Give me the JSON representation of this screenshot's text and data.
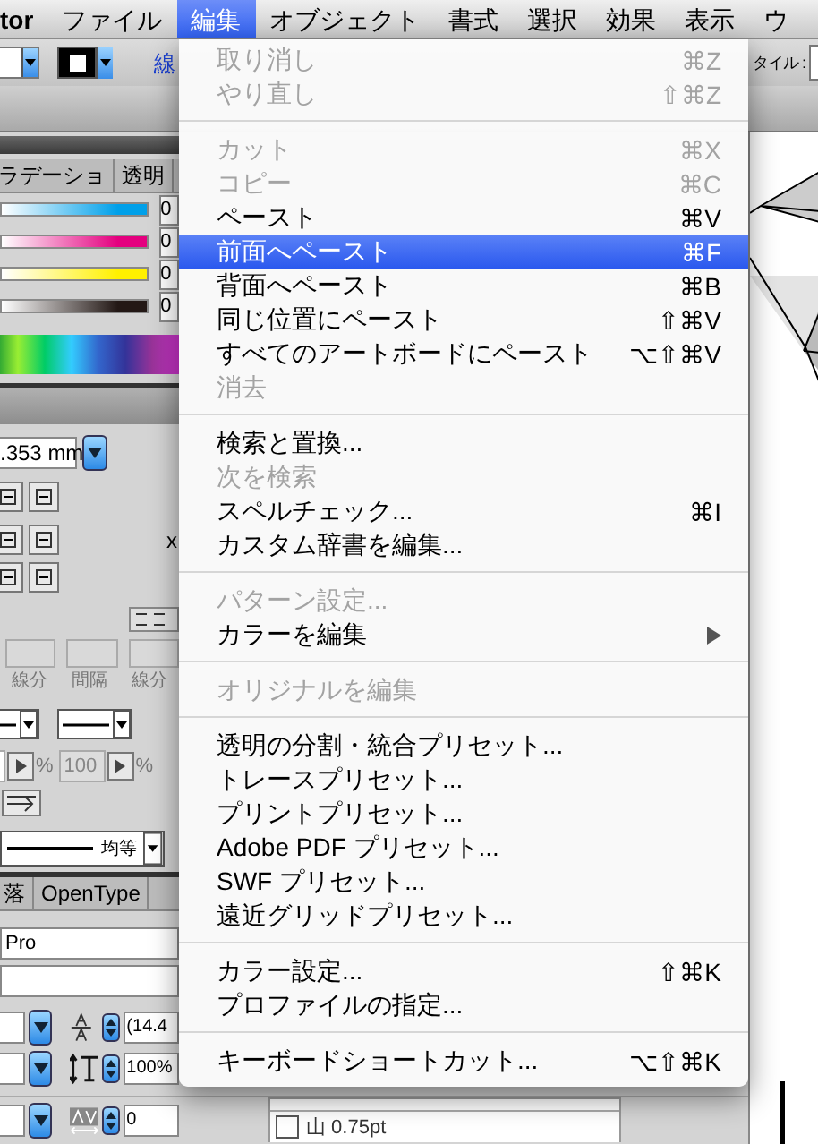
{
  "menubar": [
    {
      "label": "tor",
      "selected": false
    },
    {
      "label": "ファイル",
      "selected": false
    },
    {
      "label": "編集",
      "selected": true
    },
    {
      "label": "オブジェクト",
      "selected": false
    },
    {
      "label": "書式",
      "selected": false
    },
    {
      "label": "選択",
      "selected": false
    },
    {
      "label": "効果",
      "selected": false
    },
    {
      "label": "表示",
      "selected": false
    },
    {
      "label": "ウ",
      "selected": false
    }
  ],
  "control_bar": {
    "stroke_link": "線",
    "style_label": "タイル :"
  },
  "edit_menu": {
    "sections": [
      [
        {
          "label": "取り消し",
          "shortcut": "⌘Z",
          "disabled": true,
          "selected": false,
          "has_submenu": false
        },
        {
          "label": "やり直し",
          "shortcut": "⇧⌘Z",
          "disabled": true,
          "selected": false,
          "has_submenu": false
        }
      ],
      [
        {
          "label": "カット",
          "shortcut": "⌘X",
          "disabled": true,
          "selected": false,
          "has_submenu": false
        },
        {
          "label": "コピー",
          "shortcut": "⌘C",
          "disabled": true,
          "selected": false,
          "has_submenu": false
        },
        {
          "label": "ペースト",
          "shortcut": "⌘V",
          "disabled": false,
          "selected": false,
          "has_submenu": false
        },
        {
          "label": "前面へペースト",
          "shortcut": "⌘F",
          "disabled": false,
          "selected": true,
          "has_submenu": false
        },
        {
          "label": "背面へペースト",
          "shortcut": "⌘B",
          "disabled": false,
          "selected": false,
          "has_submenu": false
        },
        {
          "label": "同じ位置にペースト",
          "shortcut": "⇧⌘V",
          "disabled": false,
          "selected": false,
          "has_submenu": false
        },
        {
          "label": "すべてのアートボードにペースト",
          "shortcut": "⌥⇧⌘V",
          "disabled": false,
          "selected": false,
          "has_submenu": false
        },
        {
          "label": "消去",
          "disabled": true,
          "selected": false,
          "has_submenu": false
        }
      ],
      [
        {
          "label": "検索と置換...",
          "disabled": false,
          "selected": false,
          "has_submenu": false
        },
        {
          "label": "次を検索",
          "disabled": true,
          "selected": false,
          "has_submenu": false
        },
        {
          "label": "スペルチェック...",
          "shortcut": "⌘I",
          "disabled": false,
          "selected": false,
          "has_submenu": false
        },
        {
          "label": "カスタム辞書を編集...",
          "disabled": false,
          "selected": false,
          "has_submenu": false
        }
      ],
      [
        {
          "label": "パターン設定...",
          "disabled": true,
          "selected": false,
          "has_submenu": false
        },
        {
          "label": "カラーを編集",
          "disabled": false,
          "selected": false,
          "has_submenu": true
        }
      ],
      [
        {
          "label": "オリジナルを編集",
          "disabled": true,
          "selected": false,
          "has_submenu": false
        }
      ],
      [
        {
          "label": "透明の分割・統合プリセット...",
          "disabled": false,
          "selected": false,
          "has_submenu": false
        },
        {
          "label": "トレースプリセット...",
          "disabled": false,
          "selected": false,
          "has_submenu": false
        },
        {
          "label": "プリントプリセット...",
          "disabled": false,
          "selected": false,
          "has_submenu": false
        },
        {
          "label": "Adobe PDF プリセット...",
          "disabled": false,
          "selected": false,
          "has_submenu": false
        },
        {
          "label": "SWF プリセット...",
          "disabled": false,
          "selected": false,
          "has_submenu": false
        },
        {
          "label": "遠近グリッドプリセット...",
          "disabled": false,
          "selected": false,
          "has_submenu": false
        }
      ],
      [
        {
          "label": "カラー設定...",
          "shortcut": "⇧⌘K",
          "disabled": false,
          "selected": false,
          "has_submenu": false
        },
        {
          "label": "プロファイルの指定...",
          "disabled": false,
          "selected": false,
          "has_submenu": false
        }
      ],
      [
        {
          "label": "キーボードショートカット...",
          "shortcut": "⌥⇧⌘K",
          "disabled": false,
          "selected": false,
          "has_submenu": false
        }
      ]
    ]
  },
  "color_panel": {
    "tabs": [
      {
        "label": "ラデーショ",
        "selected": false
      },
      {
        "label": "透明",
        "selected": false
      }
    ],
    "sliders": [
      {
        "color": "#00a0e9",
        "value": "0"
      },
      {
        "color": "#e4007f",
        "value": "0"
      },
      {
        "color": "#fff100",
        "value": "0"
      },
      {
        "color": "#231815",
        "value": "0"
      }
    ]
  },
  "stroke_panel": {
    "weight": ".353 mm",
    "x_label": "x",
    "dash_labels": [
      "線分",
      "間隔",
      "線分"
    ],
    "scale_units": [
      "%",
      "%"
    ],
    "scale_value": "100",
    "profile": "均等"
  },
  "character_panel": {
    "tabs": [
      {
        "label": "落",
        "selected": false
      },
      {
        "label": "OpenType",
        "selected": false
      }
    ],
    "font": "Pro",
    "leading": "(14.4",
    "vertical_scale": "100%",
    "tracking": "0"
  },
  "stroke_list": [
    {
      "label": "山 0.75pt"
    }
  ]
}
